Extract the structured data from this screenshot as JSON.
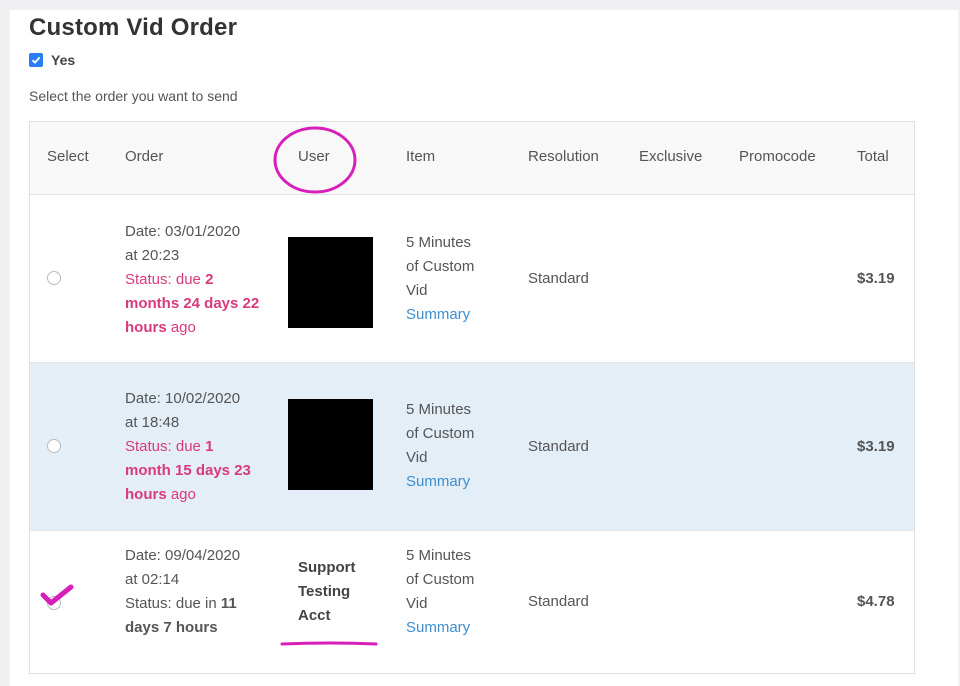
{
  "page": {
    "title": "Custom Vid Order",
    "checkbox_label": "Yes",
    "checkbox_checked": true,
    "instruction": "Select the order you want to send"
  },
  "table": {
    "headers": [
      "Select",
      "Order",
      "User",
      "Item",
      "Resolution",
      "Exclusive",
      "Promocode",
      "Total"
    ],
    "rows": [
      {
        "selected": false,
        "date_line1": "Date: 03/01/2020",
        "date_line2": "at 20:23",
        "status_line1_prefix": "Status: due ",
        "status_line1_bold": "2",
        "status_line2": "months 24 days 22",
        "status_line3_bold": "hours",
        "status_line3_rest": " ago",
        "user": "",
        "item_line1": "5 Minutes",
        "item_line2": "of Custom",
        "item_line3": "Vid",
        "item_link": "Summary",
        "resolution": "Standard",
        "exclusive": "",
        "promocode": "",
        "total": "$3.19"
      },
      {
        "selected": false,
        "date_line1": "Date: 10/02/2020",
        "date_line2": "at 18:48",
        "status_line1_prefix": "Status: due ",
        "status_line1_bold": "1",
        "status_line2": "month 15 days 23",
        "status_line3_bold": "hours",
        "status_line3_rest": " ago",
        "user": "",
        "item_line1": "5 Minutes",
        "item_line2": "of Custom",
        "item_line3": "Vid",
        "item_link": "Summary",
        "resolution": "Standard",
        "exclusive": "",
        "promocode": "",
        "total": "$3.19"
      },
      {
        "selected": true,
        "date_line1": "Date: 09/04/2020",
        "date_line2": "at 02:14",
        "status_line1_prefix": "Status: due in ",
        "status_line1_bold": "11",
        "status_line2": "days 7 hours",
        "user_line1": "Support",
        "user_line2": "Testing",
        "user_line3": "Acct",
        "item_line1": "5 Minutes",
        "item_line2": "of Custom",
        "item_line3": "Vid",
        "item_link": "Summary",
        "resolution": "Standard",
        "exclusive": "",
        "promocode": "",
        "total": "$4.78"
      }
    ]
  },
  "colors": {
    "accent": "#2a7ff0",
    "due_status": "#d93a7d",
    "link": "#3d8fd1",
    "highlight_row": "#e3eef7",
    "annotation": "#d61fb8"
  }
}
